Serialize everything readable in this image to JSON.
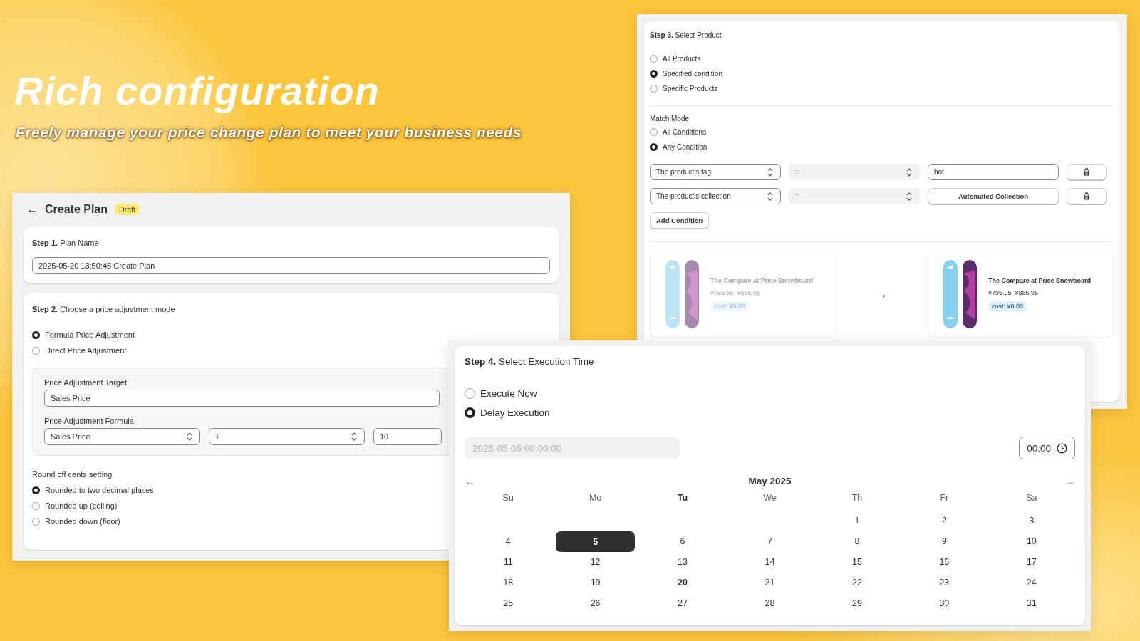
{
  "hero": {
    "title": "Rich configuration",
    "subtitle": "Freely manage your price change plan to meet your business needs"
  },
  "plan_window": {
    "back": "←",
    "title": "Create Plan",
    "badge": "Draft",
    "step1": {
      "step": "Step 1.",
      "title": "Plan Name",
      "value": "2025-05-20 13:50:45 Create Plan"
    },
    "step2": {
      "step": "Step 2.",
      "title": "Choose a price adjustment mode",
      "modes": [
        {
          "label": "Formula Price Adjustment",
          "selected": true
        },
        {
          "label": "Direct Price Adjustment",
          "selected": false
        }
      ],
      "target_label": "Price Adjustment Target",
      "target_value": "Sales Price",
      "formula_label": "Price Adjustment Formula",
      "formula": [
        {
          "kind": "select",
          "value": "Sales Price"
        },
        {
          "kind": "select",
          "value": "+"
        },
        {
          "kind": "input",
          "value": "10"
        }
      ],
      "rounding_label": "Round off cents setting",
      "rounding": [
        {
          "label": "Rounded to two decimal places",
          "selected": true
        },
        {
          "label": "Rounded up (ceiling)",
          "selected": false
        },
        {
          "label": "Rounded down (floor)",
          "selected": false
        }
      ]
    }
  },
  "product_window": {
    "step": "Step 3.",
    "title": "Select Product",
    "scopes": [
      {
        "label": "All Products",
        "selected": false
      },
      {
        "label": "Specified condition",
        "selected": true
      },
      {
        "label": "Specific Products",
        "selected": false
      }
    ],
    "match_label": "Match Mode",
    "match_modes": [
      {
        "label": "All Conditions",
        "selected": false
      },
      {
        "label": "Any Condition",
        "selected": true
      }
    ],
    "conditions": [
      {
        "field": "The product's tag",
        "operator": "=",
        "operator_disabled": true,
        "kind": "input",
        "value": "hot"
      },
      {
        "field": "The product's collection",
        "operator": "=",
        "operator_disabled": true,
        "kind": "button",
        "value": "Automated Collection"
      }
    ],
    "add_button": "Add Condition",
    "preview": {
      "arrow": "→",
      "cards": [
        {
          "name": "The Compare at Price Snowboard",
          "price": "¥785.95",
          "compare_price": "¥885.95",
          "cost": "cost: ¥0.00",
          "faded": true
        },
        {
          "name": "The Compare at Price Snowboard",
          "price": "¥795.95",
          "compare_price": "¥885.95",
          "cost": "cost: ¥0.00",
          "faded": false
        }
      ]
    }
  },
  "execution_window": {
    "step": "Step 4.",
    "title": "Select Execution Time",
    "options": [
      {
        "label": "Execute Now",
        "selected": false
      },
      {
        "label": "Delay Execution",
        "selected": true
      }
    ],
    "date_value": "2025-05-05 00:00:00",
    "time_value": "00:00",
    "calendar": {
      "prev": "←",
      "month": "May 2025",
      "next": "→",
      "weekdays": [
        {
          "label": "Su",
          "today": false
        },
        {
          "label": "Mo",
          "today": false
        },
        {
          "label": "Tu",
          "today": true
        },
        {
          "label": "We",
          "today": false
        },
        {
          "label": "Th",
          "today": false
        },
        {
          "label": "Fr",
          "today": false
        },
        {
          "label": "Sa",
          "today": false
        }
      ],
      "weeks": [
        [
          {
            "day": "1",
            "selected": false,
            "today": false
          },
          {
            "day": "2",
            "selected": false,
            "today": false
          },
          {
            "day": "3",
            "selected": false,
            "today": false
          }
        ],
        [
          {
            "day": "4",
            "selected": false,
            "today": false
          },
          {
            "day": "5",
            "selected": true,
            "today": false
          },
          {
            "day": "6",
            "selected": false,
            "today": false
          },
          {
            "day": "7",
            "selected": false,
            "today": false
          },
          {
            "day": "8",
            "selected": false,
            "today": false
          },
          {
            "day": "9",
            "selected": false,
            "today": false
          },
          {
            "day": "10",
            "selected": false,
            "today": false
          }
        ],
        [
          {
            "day": "11",
            "selected": false,
            "today": false
          },
          {
            "day": "12",
            "selected": false,
            "today": false
          },
          {
            "day": "13",
            "selected": false,
            "today": false
          },
          {
            "day": "14",
            "selected": false,
            "today": false
          },
          {
            "day": "15",
            "selected": false,
            "today": false
          },
          {
            "day": "16",
            "selected": false,
            "today": false
          },
          {
            "day": "17",
            "selected": false,
            "today": false
          }
        ],
        [
          {
            "day": "18",
            "selected": false,
            "today": false
          },
          {
            "day": "19",
            "selected": false,
            "today": false
          },
          {
            "day": "20",
            "selected": false,
            "today": true
          },
          {
            "day": "21",
            "selected": false,
            "today": false
          },
          {
            "day": "22",
            "selected": false,
            "today": false
          },
          {
            "day": "23",
            "selected": false,
            "today": false
          },
          {
            "day": "24",
            "selected": false,
            "today": false
          }
        ],
        [
          {
            "day": "25",
            "selected": false,
            "today": false
          },
          {
            "day": "26",
            "selected": false,
            "today": false
          },
          {
            "day": "27",
            "selected": false,
            "today": false
          },
          {
            "day": "28",
            "selected": false,
            "today": false
          },
          {
            "day": "29",
            "selected": false,
            "today": false
          },
          {
            "day": "30",
            "selected": false,
            "today": false
          },
          {
            "day": "31",
            "selected": false,
            "today": false
          }
        ]
      ]
    }
  }
}
